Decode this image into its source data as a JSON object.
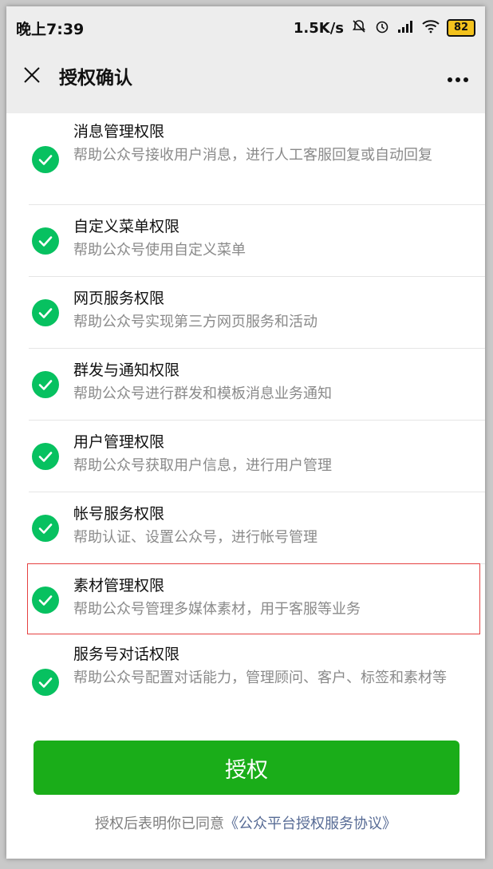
{
  "status_bar": {
    "time": "晚上7:39",
    "speed": "1.5K/s",
    "icons": [
      "notification-off-icon",
      "alarm-icon",
      "signal-icon",
      "wifi-icon"
    ],
    "battery": "82"
  },
  "header": {
    "close_icon": "close-icon",
    "title": "授权确认",
    "more_icon": "more-icon"
  },
  "permissions": [
    {
      "title": "消息管理权限",
      "desc": "帮助公众号接收用户消息，进行人工客服回复或自动回复"
    },
    {
      "title": "自定义菜单权限",
      "desc": "帮助公众号使用自定义菜单"
    },
    {
      "title": "网页服务权限",
      "desc": "帮助公众号实现第三方网页服务和活动"
    },
    {
      "title": "群发与通知权限",
      "desc": "帮助公众号进行群发和模板消息业务通知"
    },
    {
      "title": "用户管理权限",
      "desc": "帮助公众号获取用户信息，进行用户管理"
    },
    {
      "title": "帐号服务权限",
      "desc": "帮助认证、设置公众号，进行帐号管理"
    },
    {
      "title": "素材管理权限",
      "desc": "帮助公众号管理多媒体素材，用于客服等业务"
    },
    {
      "title": "服务号对话权限",
      "desc": "帮助公众号配置对话能力，管理顾问、客户、标签和素材等"
    }
  ],
  "footer": {
    "authorize_button": "授权",
    "agreement_prefix": "授权后表明你已同意",
    "agreement_link": "《公众平台授权服务协议》"
  },
  "colors": {
    "accent_green": "#1aad19",
    "check_green": "#07c160",
    "link_blue": "#576b95",
    "highlight_red": "#e54141"
  }
}
